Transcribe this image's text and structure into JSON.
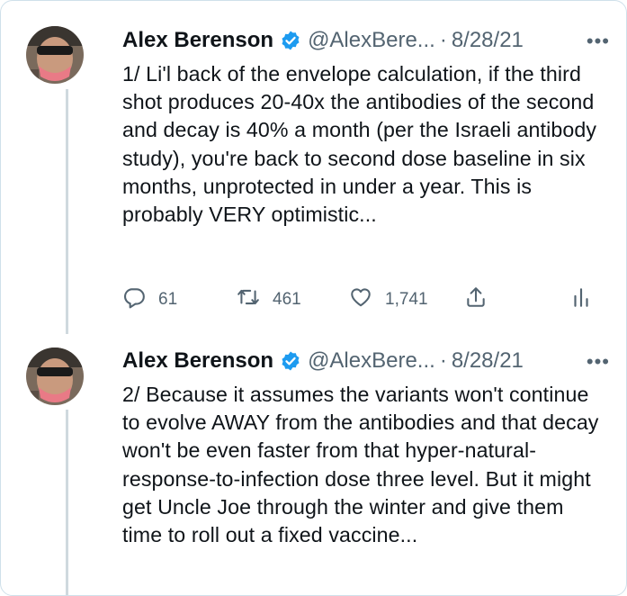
{
  "tweets": [
    {
      "name": "Alex Berenson",
      "handle": "@AlexBere...",
      "separator": "·",
      "date": "8/28/21",
      "more": "•••",
      "text": "1/ Li'l back of the envelope calculation, if the third shot produces 20-40x the antibodies of the second and decay is 40% a month (per the Israeli antibody study), you're back to second dose baseline in six months, unprotected in under a year. This is probably VERY optimistic...",
      "replies": "61",
      "retweets": "461",
      "likes": "1,741"
    },
    {
      "name": "Alex Berenson",
      "handle": "@AlexBere...",
      "separator": "·",
      "date": "8/28/21",
      "more": "•••",
      "text": "2/ Because it assumes the variants won't continue to evolve AWAY from the antibodies and that decay won't be even faster from that hyper-natural-response-to-infection dose three level. But it might get Uncle Joe through the winter and give them time to roll out a fixed vaccine..."
    }
  ],
  "icons": [
    "reply-icon",
    "retweet-icon",
    "like-icon",
    "share-icon",
    "analytics-icon",
    "verified-badge-icon",
    "more-options-icon"
  ],
  "colors": {
    "verified": "#1d9bf0",
    "secondary_text": "#536471",
    "thread_line": "#cfd9de",
    "border": "#cfe0ea"
  }
}
